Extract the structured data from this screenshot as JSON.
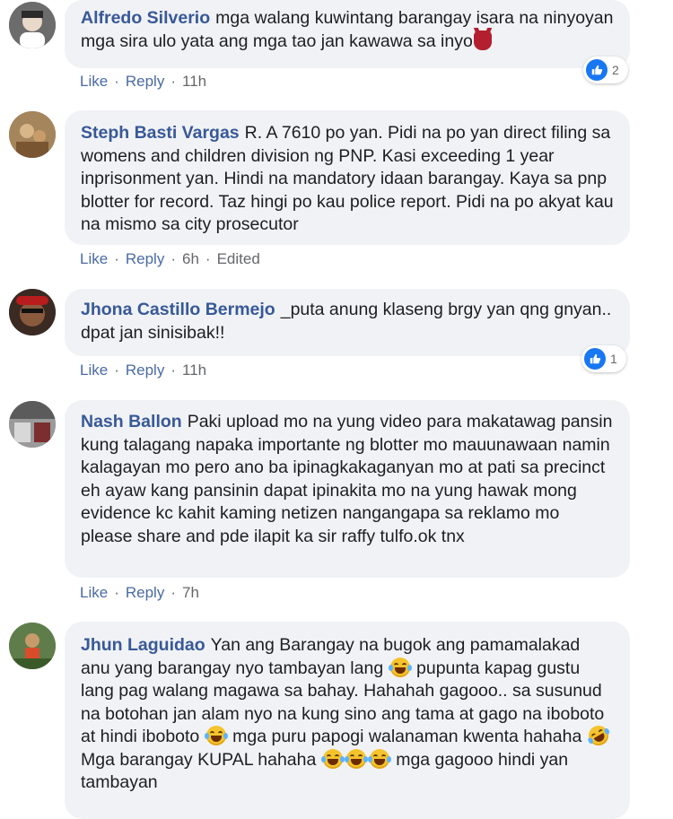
{
  "actions": {
    "like": "Like",
    "reply": "Reply",
    "separator": "·"
  },
  "comments": [
    {
      "author": "Alfredo Silverio",
      "text": "mga walang kuwintang barangay isara na ninyoyan mga sira ulo yata ang mga tao jan kawawa sa inyo",
      "time": "11h",
      "edited": "",
      "reactions": "2",
      "avatar_icon": "profile-photo"
    },
    {
      "author": "Steph Basti Vargas",
      "text": "R. A 7610 po yan. Pidi na po yan direct filing sa womens and children division ng PNP. Kasi exceeding 1 year inprisonment yan. Hindi na mandatory idaan barangay. Kaya sa pnp blotter for record. Taz hingi po kau police report. Pidi na po akyat kau na mismo sa city prosecutor",
      "time": "6h",
      "edited": "Edited",
      "reactions": "",
      "avatar_icon": "profile-photo"
    },
    {
      "author": "Jhona Castillo Bermejo",
      "text": "_puta anung klaseng brgy yan qng gnyan.. dpat jan sinisibak!!",
      "time": "11h",
      "edited": "",
      "reactions": "1",
      "avatar_icon": "profile-photo"
    },
    {
      "author": "Nash Ballon",
      "text": "Paki upload mo na yung video para makatawag pansin kung talagang napaka importante ng blotter mo mauunawaan namin kalagayan mo pero ano ba ipinagkakaganyan mo at pati sa precinct eh ayaw kang pansinin dapat ipinakita mo na yung hawak mong evidence kc kahit kaming netizen nangangapa sa reklamo mo please share and pde ilapit ka sir raffy tulfo.ok tnx",
      "time": "7h",
      "edited": "",
      "reactions": "",
      "avatar_icon": "profile-photo"
    },
    {
      "author": "Jhun Laguidao",
      "text_parts": [
        "Yan ang Barangay na bugok ang pamamalakad anu yang barangay nyo tambayan lang",
        "pupunta kapag gustu lang pag walang magawa sa bahay. Hahahah gagooo.. sa susunud na botohan jan alam nyo na kung sino ang tama at gago na iboboto at hindi iboboto",
        "mga puru papogi walanaman kwenta hahaha",
        "Mga barangay KUPAL hahaha",
        "mga gagooo hindi yan tambayan"
      ],
      "avatar_icon": "profile-photo"
    }
  ],
  "icons": {
    "like_reaction": "thumbs-up-icon",
    "laugh_emoji": "tears-of-joy-icon",
    "devil_emoji": "devil-icon",
    "rofl_emoji": "rolling-laughing-icon"
  },
  "colors": {
    "name": "#385898",
    "bubble": "#f0f2f5",
    "like_blue": "#1877f2",
    "action": "#4b6aa5"
  }
}
